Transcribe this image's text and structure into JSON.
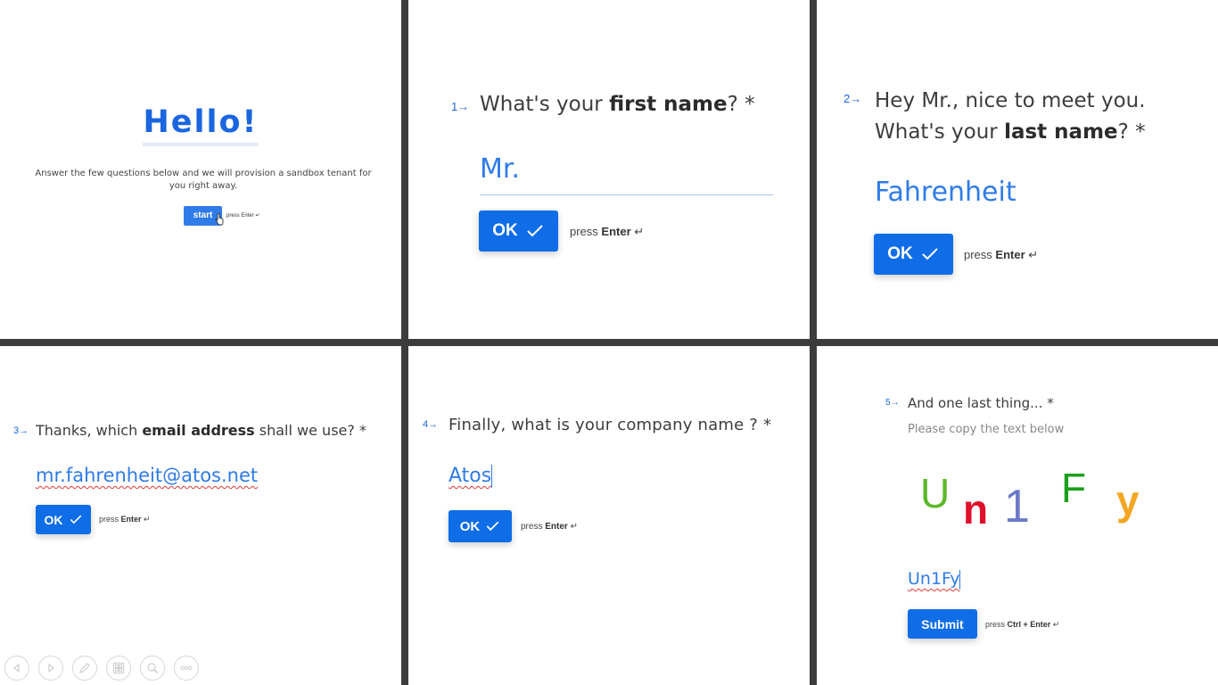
{
  "welcome": {
    "title": "Hello!",
    "intro": "Answer the few questions below and we will provision a sandbox tenant for you right away.",
    "start_label": "start",
    "hint": "press Enter ↵"
  },
  "q1": {
    "number": "1",
    "text_before": "What's your ",
    "text_bold": "first name",
    "text_after": "? *",
    "answer": "Mr.",
    "ok_label": "OK",
    "hint_prefix": "press ",
    "hint_key": "Enter",
    "hint_suffix": " ↵"
  },
  "q2": {
    "number": "2",
    "line1": "Hey Mr., nice to meet you.",
    "text_before": "What's your ",
    "text_bold": "last name",
    "text_after": "? *",
    "answer": "Fahrenheit",
    "ok_label": "OK",
    "hint_prefix": "press ",
    "hint_key": "Enter",
    "hint_suffix": " ↵"
  },
  "q3": {
    "number": "3",
    "text_before": "Thanks, which ",
    "text_bold": "email address",
    "text_after": " shall we use? *",
    "answer": "mr.fahrenheit@atos.net",
    "ok_label": "OK",
    "hint_prefix": "press ",
    "hint_key": "Enter",
    "hint_suffix": " ↵"
  },
  "q4": {
    "number": "4",
    "text": "Finally, what is your company name ? *",
    "answer": "Atos",
    "ok_label": "OK",
    "hint_prefix": "press ",
    "hint_key": "Enter",
    "hint_suffix": " ↵"
  },
  "q5": {
    "number": "5",
    "text": "And one last thing... *",
    "subtext": "Please copy the text below",
    "captcha_chars": [
      {
        "char": "U",
        "color": "#5cb82a"
      },
      {
        "char": "n",
        "color": "#e0102a"
      },
      {
        "char": "1",
        "color": "#6c79c8"
      },
      {
        "char": "F",
        "color": "#1aa01a"
      },
      {
        "char": "y",
        "color": "#f5a623"
      }
    ],
    "answer": "Un1Fy",
    "submit_label": "Submit",
    "hint_prefix": "press ",
    "hint_key": "Ctrl + Enter",
    "hint_suffix": " ↵"
  },
  "toolbar": {
    "buttons": [
      "previous-icon",
      "next-icon",
      "pen-icon",
      "slides-icon",
      "zoom-icon",
      "more-icon"
    ]
  },
  "colors": {
    "accent": "#0f6de8",
    "answer_text": "#2f7be8",
    "divider": "#3c3c3c"
  }
}
